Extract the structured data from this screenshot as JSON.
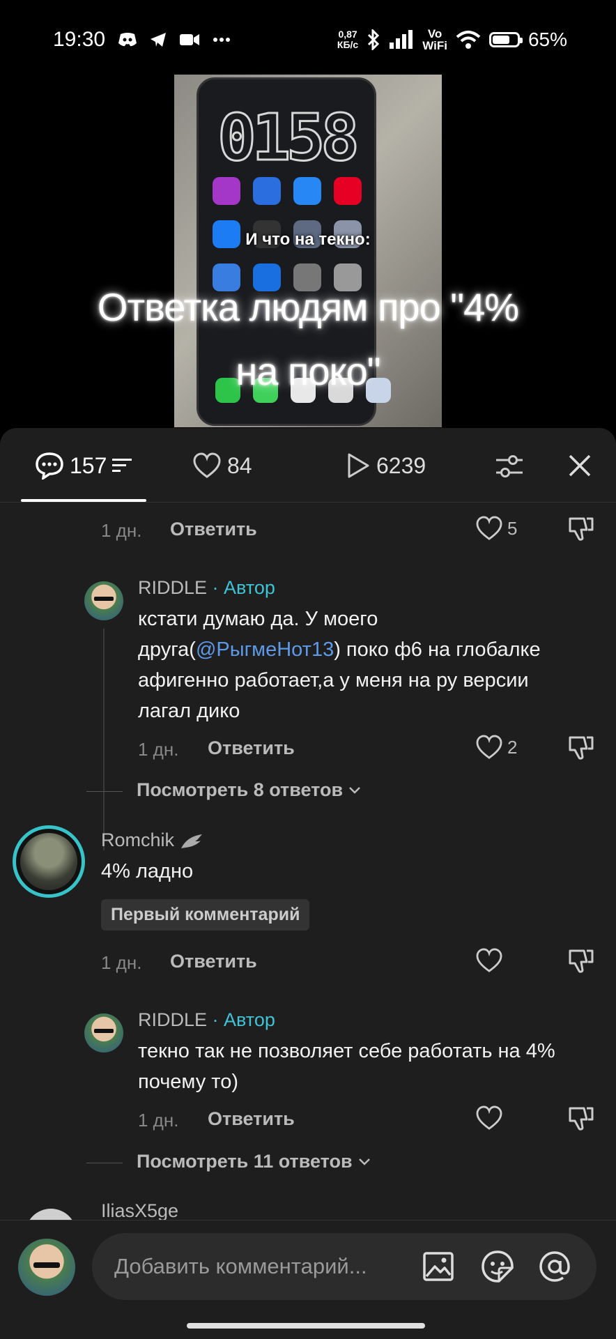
{
  "status_bar": {
    "time": "19:30",
    "net_speed_value": "0,87",
    "net_speed_unit": "КБ/с",
    "vowifi_top": "Vo",
    "vowifi_bottom": "WiFi",
    "battery": "65%",
    "battery_level": 0.65,
    "icons": [
      "discord-icon",
      "telegram-icon",
      "video-camera-icon",
      "more-dots-icon",
      "bluetooth-icon",
      "signal-icon",
      "wifi-icon",
      "battery-icon"
    ]
  },
  "video": {
    "phone_clock": "0158",
    "overlay_small": "И что на текно:",
    "overlay_title_line1": "Ответка людям про \"4%",
    "overlay_title_line2": "на поко\""
  },
  "tabs": {
    "comments_count": "157",
    "likes_count": "84",
    "views_count": "6239"
  },
  "colors": {
    "accent": "#3fc4d6",
    "mention": "#5e9ae8",
    "sheet_bg": "#1e1e1e"
  },
  "comments": {
    "top_partial": {
      "time": "1 дн.",
      "reply": "Ответить",
      "likes": "5"
    },
    "reply1": {
      "author": "RIDDLE",
      "author_tag": "· Автор",
      "text_before": "кстати думаю да. У моего друга(",
      "mention": "@РыгмеНот13",
      "text_after": ") поко ф6 на глобалке афигенно работает,а у меня на ру версии лагал дико",
      "time": "1 дн.",
      "reply": "Ответить",
      "likes": "2"
    },
    "more1": "Посмотреть 8 ответов",
    "comment2": {
      "author": "Romchik",
      "text": "4% ладно",
      "badge": "Первый комментарий",
      "time": "1 дн.",
      "reply": "Ответить"
    },
    "reply2": {
      "author": "RIDDLE",
      "author_tag": "· Автор",
      "text": "текно так не позволяет себе работать на 4% почему то)",
      "time": "1 дн.",
      "reply": "Ответить"
    },
    "more2": "Посмотреть 11 ответов",
    "comment3_partial": {
      "author": "IliasX5ge"
    }
  },
  "composer": {
    "placeholder": "Добавить комментарий..."
  }
}
